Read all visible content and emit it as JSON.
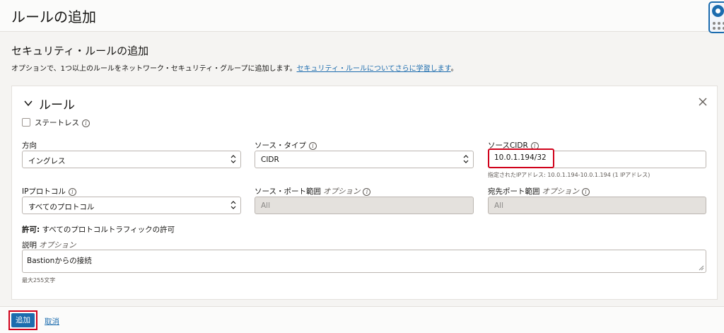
{
  "header": {
    "title": "ルールの追加"
  },
  "section": {
    "title": "セキュリティ・ルールの追加",
    "description": "オプションで、1つ以上のルールをネットワーク・セキュリティ・グループに追加します。",
    "link_text": "セキュリティ・ルールについてさらに学習します",
    "description_end": "。"
  },
  "rule": {
    "title": "ルール",
    "stateless_label": "ステートレス",
    "direction": {
      "label": "方向",
      "value": "イングレス"
    },
    "source_type": {
      "label": "ソース・タイプ",
      "value": "CIDR"
    },
    "source_cidr": {
      "label": "ソースCIDR",
      "value": "10.0.1.194/32",
      "hint": "指定されたIPアドレス: 10.0.1.194-10.0.1.194 (1 IPアドレス)"
    },
    "ip_protocol": {
      "label": "IPプロトコル",
      "value": "すべてのプロトコル"
    },
    "source_port": {
      "label": "ソース・ポート範囲",
      "optional": "オプション",
      "placeholder": "All"
    },
    "dest_port": {
      "label": "宛先ポート範囲",
      "optional": "オプション",
      "placeholder": "All"
    },
    "allow": {
      "label": "許可:",
      "text": "すべてのプロトコルトラフィックの許可"
    },
    "description": {
      "label": "説明",
      "optional": "オプション",
      "value": "Bastionからの接続",
      "hint": "最大255文字"
    }
  },
  "footer": {
    "add_label": "追加",
    "cancel_label": "取消"
  },
  "icons": {
    "help": "lifebuoy-icon",
    "chevron": "chevron-down-icon",
    "close": "close-icon",
    "info": "info-icon",
    "select_arrows": "select-arrows-icon"
  },
  "colors": {
    "accent": "#1c6cae",
    "highlight": "#d0021b"
  }
}
